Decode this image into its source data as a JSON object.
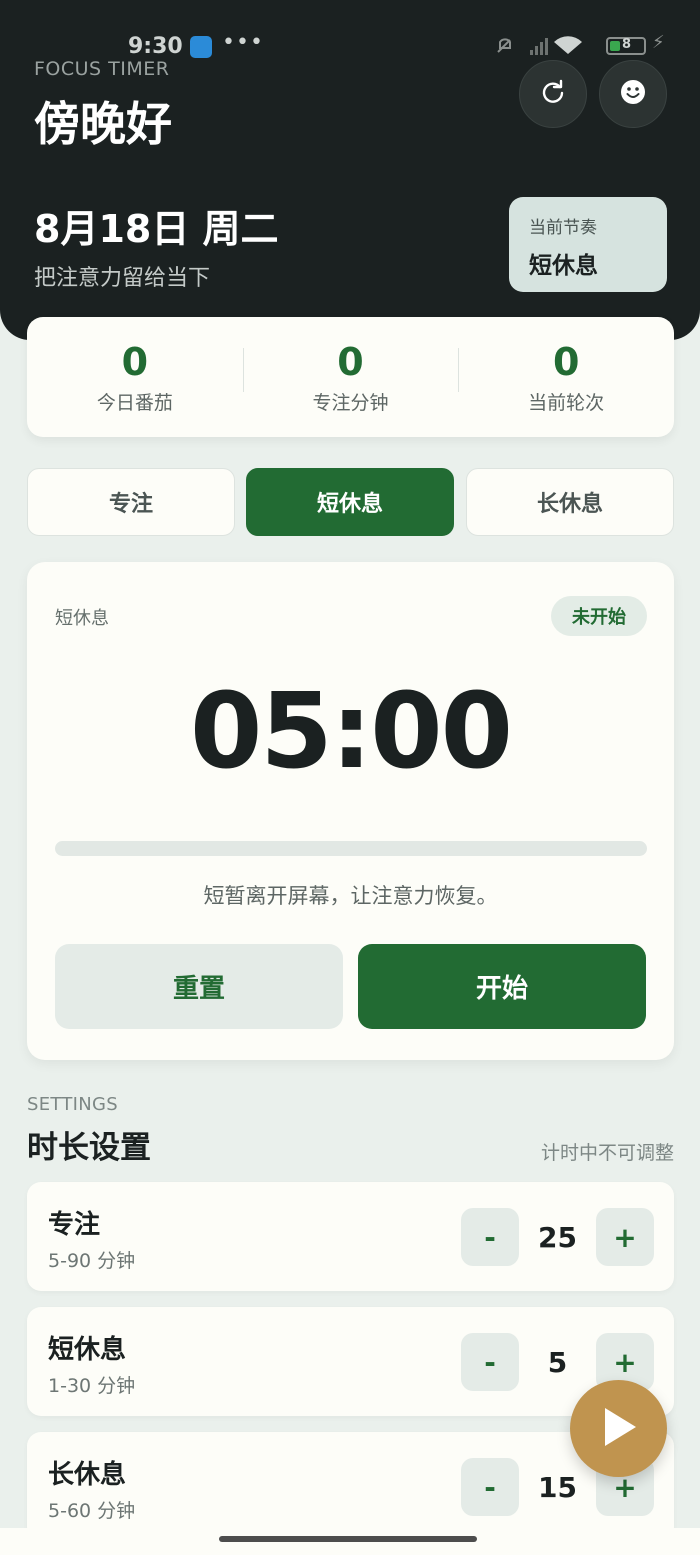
{
  "status_bar": {
    "time": "9:30",
    "dots": "•••",
    "battery": "8"
  },
  "header": {
    "eyebrow": "FOCUS TIMER",
    "greeting": "傍晚好",
    "date": "8月18日 周二",
    "subtitle": "把注意力留给当下",
    "rhythm_label": "当前节奏",
    "rhythm_value": "短休息",
    "reset_icon": "↻",
    "theme_icon": "smiley-icon"
  },
  "stats": [
    {
      "value": "0",
      "label": "今日番茄"
    },
    {
      "value": "0",
      "label": "专注分钟"
    },
    {
      "value": "0",
      "label": "当前轮次"
    }
  ],
  "modes": [
    {
      "label": "专注",
      "active": false
    },
    {
      "label": "短休息",
      "active": true
    },
    {
      "label": "长休息",
      "active": false
    }
  ],
  "timer": {
    "mode_label": "短休息",
    "status_badge": "未开始",
    "time": "05:00",
    "progress": 0,
    "hint": "短暂离开屏幕，让注意力恢复。",
    "reset_label": "重置",
    "start_label": "开始"
  },
  "settings": {
    "eyebrow": "SETTINGS",
    "title": "时长设置",
    "note": "计时中不可调整",
    "rows": [
      {
        "name": "专注",
        "range": "5-90 分钟",
        "value": "25"
      },
      {
        "name": "短休息",
        "range": "1-30 分钟",
        "value": "5"
      },
      {
        "name": "长休息",
        "range": "5-60 分钟",
        "value": "15"
      }
    ],
    "minus_label": "-",
    "plus_label": "+"
  },
  "colors": {
    "primary": "#226b33",
    "header_bg": "#1b2121",
    "fab": "#c0944f",
    "page_bg": "#eaf0ec"
  }
}
